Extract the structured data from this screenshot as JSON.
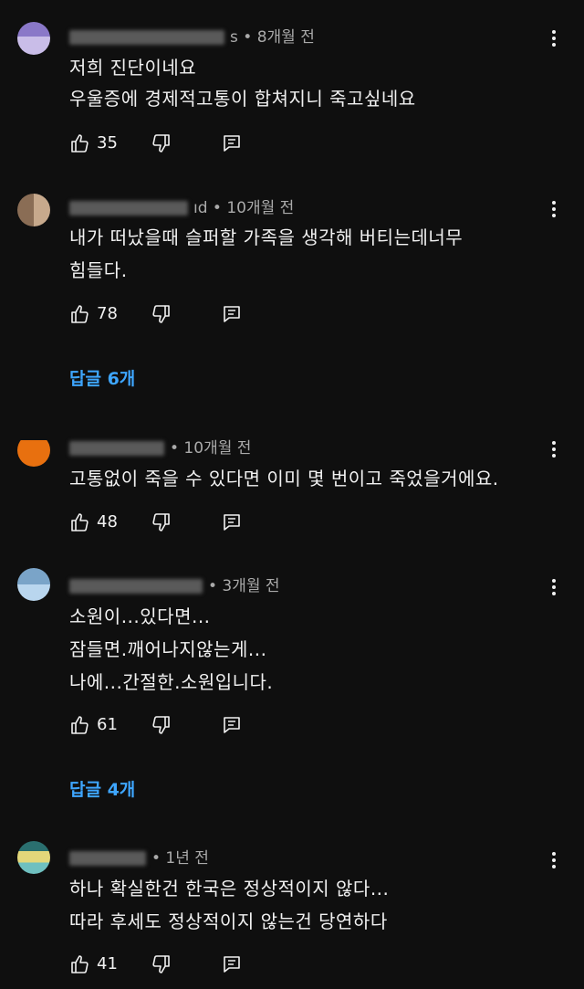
{
  "comments": [
    {
      "time": "s • 8개월 전",
      "lines": [
        "저희  진단이네요",
        "우울증에  경제적고통이 합쳐지니  죽고싶네요"
      ],
      "likes": "35",
      "avatar_colors": [
        "#8a78c8",
        "#c9bde8"
      ]
    },
    {
      "time": "ıd • 10개월 전",
      "lines": [
        "내가 떠났을때 슬퍼할 가족을 생각해 버티는데너무",
        "힘들다."
      ],
      "likes": "78",
      "replies": "답글 6개",
      "avatar_colors": [
        "#8a6d55",
        "#c7a98c"
      ]
    },
    {
      "time": "• 10개월 전",
      "lines": [
        "고통없이 죽을 수 있다면 이미 몇 번이고 죽었을거에요."
      ],
      "likes": "48",
      "avatar_colors": [
        "#e8700f",
        "#e8700f"
      ]
    },
    {
      "time": "• 3개월 전",
      "lines": [
        "소원이...있다면...",
        "잠들면.깨어나지않는게...",
        "나에...간절한.소원입니다."
      ],
      "likes": "61",
      "replies": "답글 4개",
      "avatar_colors": [
        "#7aa4c8",
        "#b9d6ee"
      ]
    },
    {
      "time": "• 1년 전",
      "lines": [
        "하나 확실한건 한국은 정상적이지 않다...",
        "따라 후세도 정상적이지 않는건 당연하다"
      ],
      "likes": "41",
      "avatar_colors": [
        "#e3d77a",
        "#6fc0c0"
      ]
    }
  ],
  "icons": {
    "like": "thumbs-up-icon",
    "dislike": "thumbs-down-icon",
    "reply": "reply-icon",
    "more": "more-vert-icon"
  }
}
